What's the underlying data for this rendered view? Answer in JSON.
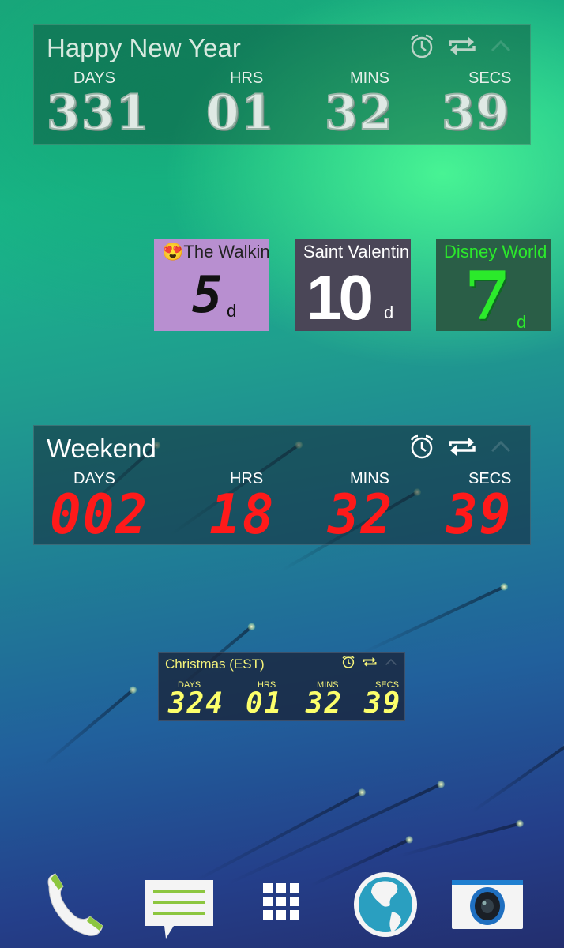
{
  "widgets": {
    "new_year": {
      "title": "Happy New Year",
      "labels": {
        "days": "DAYS",
        "hrs": "HRS",
        "mins": "MINS",
        "secs": "SECS"
      },
      "values": {
        "days": "331",
        "hrs": "01",
        "mins": "32",
        "secs": "39"
      },
      "icons": [
        "alarm-icon",
        "repeat-icon",
        "collapse-icon"
      ]
    },
    "small": [
      {
        "title": "😍The Walkin",
        "value": "5",
        "unit": "d",
        "bg": "#b88fd0",
        "color": "#111111"
      },
      {
        "title": "Saint Valentin",
        "value": "10",
        "unit": "d",
        "bg": "#4a4657",
        "color": "#ffffff"
      },
      {
        "title": "Disney World",
        "value": "7",
        "unit": "d",
        "bg": "#2a5e47",
        "color": "#2bea2b"
      }
    ],
    "weekend": {
      "title": "Weekend",
      "labels": {
        "days": "DAYS",
        "hrs": "HRS",
        "mins": "MINS",
        "secs": "SECS"
      },
      "values": {
        "days": "002",
        "hrs": "18",
        "mins": "32",
        "secs": "39"
      },
      "digit_color": "#ff1a1a"
    },
    "christmas": {
      "title": "Christmas (EST)",
      "labels": {
        "days": "DAYS",
        "hrs": "HRS",
        "mins": "MINS",
        "secs": "SECS"
      },
      "values": {
        "days": "324",
        "hrs": "01",
        "mins": "32",
        "secs": "39"
      },
      "digit_color": "#fcff6b"
    }
  },
  "dock": [
    {
      "name": "phone",
      "icon": "phone-icon"
    },
    {
      "name": "messages",
      "icon": "messages-icon"
    },
    {
      "name": "app-drawer",
      "icon": "apps-grid-icon"
    },
    {
      "name": "browser",
      "icon": "globe-icon"
    },
    {
      "name": "camera",
      "icon": "camera-icon"
    }
  ]
}
